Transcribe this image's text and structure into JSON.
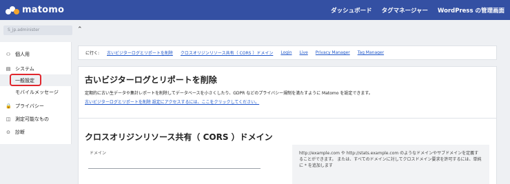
{
  "topbar": {
    "logo_text": "matomo",
    "nav": [
      "ダッシュボード",
      "タグマネージャー",
      "WordPress の管理画面"
    ]
  },
  "site_selector": {
    "value": "S_jp.administer"
  },
  "collapse_icon": "⌃",
  "sidebar": {
    "items": [
      {
        "icon": "person-icon",
        "glyph": "⚇",
        "label": "個人用"
      },
      {
        "icon": "system-icon",
        "glyph": "▤",
        "label": "システム"
      },
      {
        "icon": "",
        "glyph": "",
        "label": "一般設定",
        "active": true,
        "sub": true
      },
      {
        "icon": "",
        "glyph": "",
        "label": "モバイルメッセージ",
        "sub": true
      },
      {
        "icon": "lock-icon",
        "glyph": "🔒",
        "label": "プライバシー"
      },
      {
        "icon": "measurable-icon",
        "glyph": "◫",
        "label": "測定可能なもの"
      },
      {
        "icon": "diagnostic-icon",
        "glyph": "⊙",
        "label": "診断"
      }
    ]
  },
  "goto": {
    "label": "に行く:",
    "links": [
      "古いビジターログとリポートを削除",
      "クロスオリジンリソース共有（ CORS ）ドメイン",
      "Login",
      "Live",
      "Privacy Manager",
      "Tag Manager"
    ]
  },
  "delete_section": {
    "title": "古いビジターログとリポートを削除",
    "description": "定期的に古い生データや集計レポートを削除してデータベースを小さくしたり、GDPR などのプライバシー規制を満たすように Matomo を設定できます。",
    "link": "古いビジターログとリポートを削除 設定にアクセスするには、ここをクリックしてください。"
  },
  "cors_section": {
    "title": "クロスオリジンリソース共有（ CORS ）ドメイン",
    "field_label": "ドメイン",
    "field_value": "",
    "help": "http://example.com や http://stats.example.com のようなドメインやサブドメインを定義することができます。 または、すべてのドメインに対してクロスドメイン要求を許可するには、単純に * を追加します"
  }
}
